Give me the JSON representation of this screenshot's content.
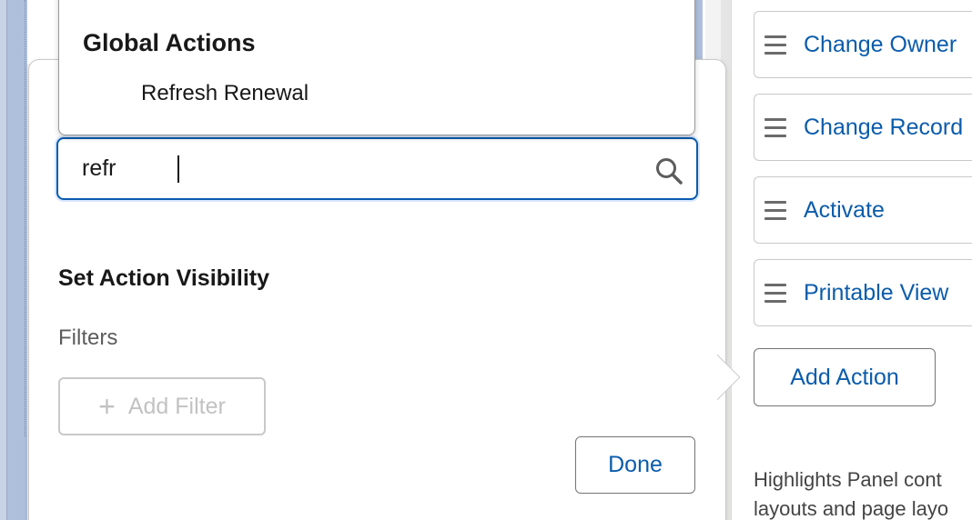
{
  "dropdown": {
    "group_title": "Global Actions",
    "options": [
      "Refresh Renewal"
    ]
  },
  "search": {
    "value": "refr",
    "placeholder": ""
  },
  "visibility": {
    "title": "Set Action Visibility",
    "filters_label": "Filters",
    "add_filter_label": "Add Filter"
  },
  "done_label": "Done",
  "actions": {
    "items": [
      "Change Owner",
      "Change Record",
      "Activate",
      "Printable View"
    ],
    "add_action_label": "Add Action"
  },
  "helper_text": {
    "line1": "Highlights Panel cont",
    "line2": "layouts and page layo"
  },
  "icons": {
    "search": "search-icon",
    "drag": "drag-handle-icon",
    "plus": "plus-icon"
  },
  "colors": {
    "accent": "#0b5cab",
    "focus_ring": "#d8e6fe"
  }
}
